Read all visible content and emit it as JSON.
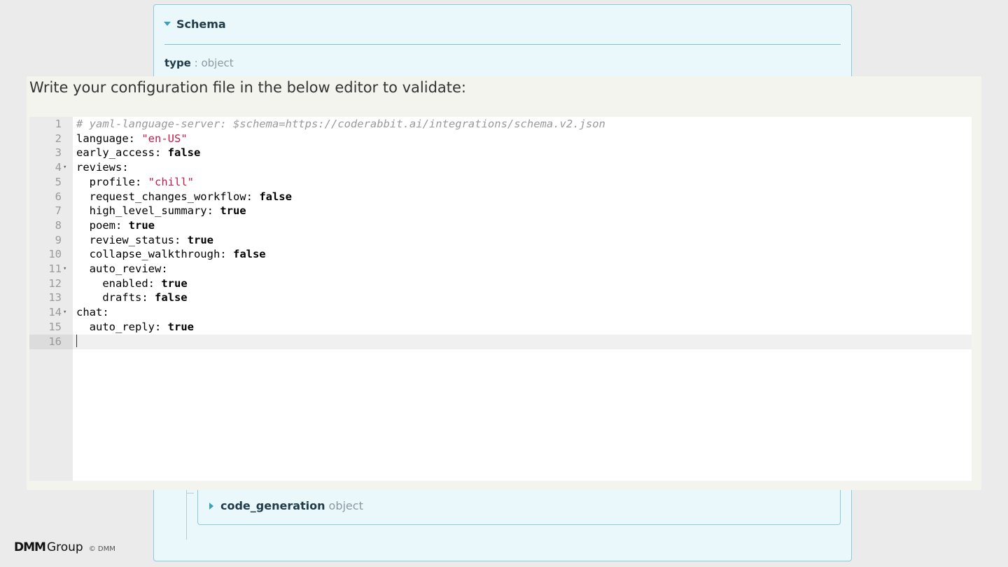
{
  "schema": {
    "title": "Schema",
    "type_key": "type",
    "type_value": ": object",
    "child": {
      "name": "code_generation",
      "type": "object"
    }
  },
  "overlay": {
    "heading": "Write your configuration file in the below editor to validate:"
  },
  "editor": {
    "lines": [
      {
        "num": "1",
        "fold": "",
        "indent": "",
        "parts": [
          {
            "t": "# yaml-language-server: $schema=https://coderabbit.ai/integrations/schema.v2.json",
            "c": "cmt"
          }
        ]
      },
      {
        "num": "2",
        "fold": "",
        "indent": "",
        "parts": [
          {
            "t": "language: ",
            "c": ""
          },
          {
            "t": "\"en-US\"",
            "c": "str"
          }
        ]
      },
      {
        "num": "3",
        "fold": "",
        "indent": "",
        "parts": [
          {
            "t": "early_access: ",
            "c": ""
          },
          {
            "t": "false",
            "c": "kw"
          }
        ]
      },
      {
        "num": "4",
        "fold": "▾",
        "indent": "",
        "parts": [
          {
            "t": "reviews:",
            "c": ""
          }
        ]
      },
      {
        "num": "5",
        "fold": "",
        "indent": "  ",
        "parts": [
          {
            "t": "profile: ",
            "c": ""
          },
          {
            "t": "\"chill\"",
            "c": "str"
          }
        ]
      },
      {
        "num": "6",
        "fold": "",
        "indent": "  ",
        "parts": [
          {
            "t": "request_changes_workflow: ",
            "c": ""
          },
          {
            "t": "false",
            "c": "kw"
          }
        ]
      },
      {
        "num": "7",
        "fold": "",
        "indent": "  ",
        "parts": [
          {
            "t": "high_level_summary: ",
            "c": ""
          },
          {
            "t": "true",
            "c": "kw"
          }
        ]
      },
      {
        "num": "8",
        "fold": "",
        "indent": "  ",
        "parts": [
          {
            "t": "poem: ",
            "c": ""
          },
          {
            "t": "true",
            "c": "kw"
          }
        ]
      },
      {
        "num": "9",
        "fold": "",
        "indent": "  ",
        "parts": [
          {
            "t": "review_status: ",
            "c": ""
          },
          {
            "t": "true",
            "c": "kw"
          }
        ]
      },
      {
        "num": "10",
        "fold": "",
        "indent": "  ",
        "parts": [
          {
            "t": "collapse_walkthrough: ",
            "c": ""
          },
          {
            "t": "false",
            "c": "kw"
          }
        ]
      },
      {
        "num": "11",
        "fold": "▾",
        "indent": "  ",
        "parts": [
          {
            "t": "auto_review:",
            "c": ""
          }
        ]
      },
      {
        "num": "12",
        "fold": "",
        "indent": "    ",
        "parts": [
          {
            "t": "enabled: ",
            "c": ""
          },
          {
            "t": "true",
            "c": "kw"
          }
        ]
      },
      {
        "num": "13",
        "fold": "",
        "indent": "    ",
        "parts": [
          {
            "t": "drafts: ",
            "c": ""
          },
          {
            "t": "false",
            "c": "kw"
          }
        ]
      },
      {
        "num": "14",
        "fold": "▾",
        "indent": "",
        "parts": [
          {
            "t": "chat:",
            "c": ""
          }
        ]
      },
      {
        "num": "15",
        "fold": "",
        "indent": "  ",
        "parts": [
          {
            "t": "auto_reply: ",
            "c": ""
          },
          {
            "t": "true",
            "c": "kw"
          }
        ]
      },
      {
        "num": "16",
        "fold": "",
        "indent": "",
        "parts": [],
        "active": true
      }
    ]
  },
  "footer": {
    "logo_mark": "DMM",
    "logo_group": "Group",
    "copyright": "© DMM"
  }
}
